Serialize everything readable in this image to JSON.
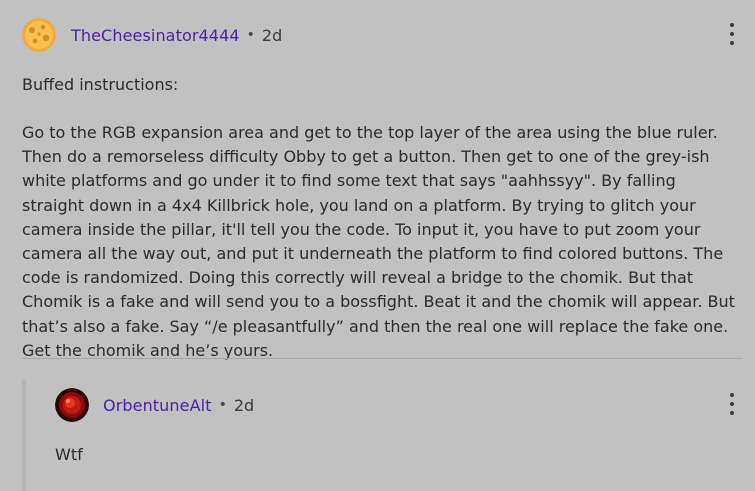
{
  "post": {
    "username": "TheCheesinator4444",
    "separator": "•",
    "time": "2d",
    "paragraph_1": "Buffed instructions:",
    "paragraph_2": "Go to the RGB expansion area and get to the top layer of the area using the blue ruler. Then do a remorseless difficulty Obby to get a button. Then get to one of the grey-ish white platforms and go under it to find some text that says \"aahhssyy\". By falling straight down in a 4x4 Killbrick hole, you land on a platform. By trying to glitch your camera inside the pillar, it'll tell you the code. To input it, you have to put zoom your camera all the way out, and put it underneath the platform to find colored buttons. The code is randomized. Doing this correctly will reveal a bridge to the chomik. But that Chomik is a fake and will send you to a bossfight. Beat it and the chomik will appear. But that’s also a fake. Say “/e pleasantfully” and then the real one will replace the fake one. Get the chomik and he’s yours.",
    "avatar_icon": "cheese-avatar-icon",
    "menu_icon": "more-vertical-icon"
  },
  "reply": {
    "username": "OrbentuneAlt",
    "separator": "•",
    "time": "2d",
    "text": "Wtf",
    "avatar_icon": "red-orb-avatar-icon",
    "menu_icon": "more-vertical-icon"
  },
  "colors": {
    "background": "#c1c1c1",
    "username": "#4a1fa8",
    "text": "#2b2b2b"
  }
}
